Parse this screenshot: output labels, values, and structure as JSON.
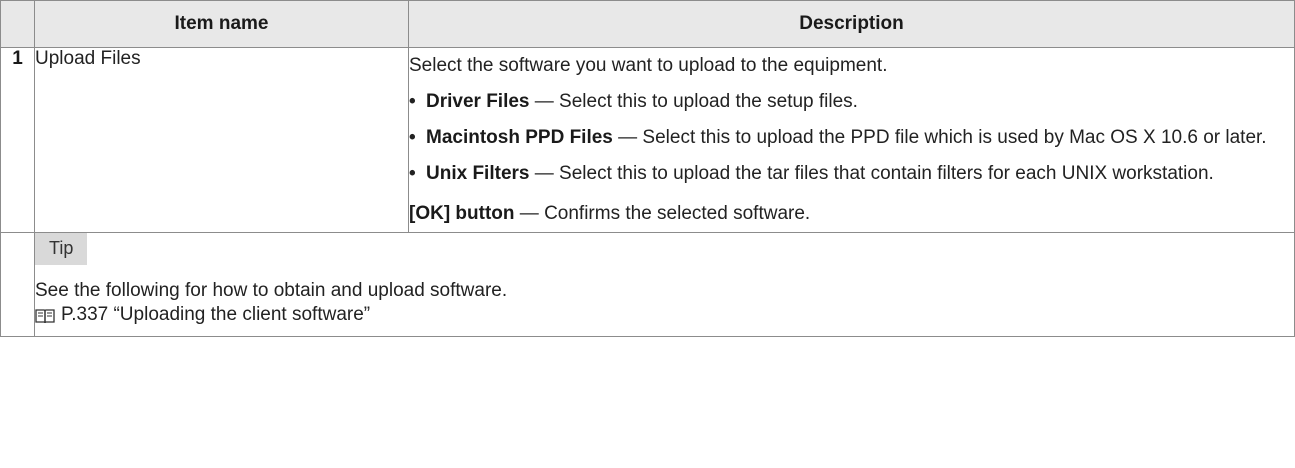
{
  "table": {
    "headers": {
      "item_name": "Item name",
      "description": "Description"
    },
    "rows": [
      {
        "number": "1",
        "name": "Upload Files",
        "intro": "Select the software you want to upload to the equipment.",
        "bullets": [
          {
            "term": "Driver Files",
            "text": " — Select this to upload the setup files."
          },
          {
            "term": "Macintosh PPD Files",
            "text": " — Select this to upload the PPD file which is used by Mac OS X 10.6 or later."
          },
          {
            "term": "Unix Filters",
            "text": " — Select this to upload the tar files that contain filters for each UNIX workstation."
          }
        ],
        "button_term": "[OK] button",
        "button_text": " — Confirms the selected software."
      }
    ]
  },
  "tip": {
    "label": "Tip",
    "text": "See the following for how to obtain and upload software.",
    "reference": "P.337 “Uploading the client software”",
    "icon": "book-reference-icon"
  }
}
